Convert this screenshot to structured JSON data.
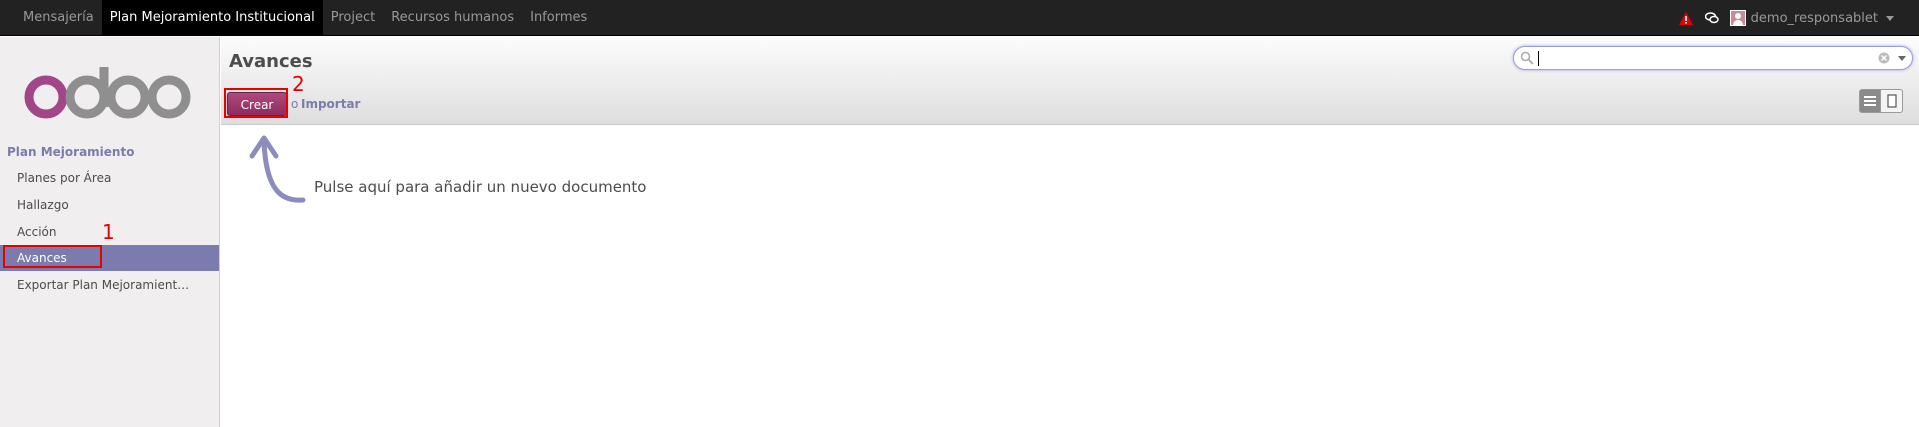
{
  "top_menu": {
    "items": [
      {
        "label": "Mensajería",
        "active": false
      },
      {
        "label": "Plan Mejoramiento Institucional",
        "active": true
      },
      {
        "label": "Project",
        "active": false
      },
      {
        "label": "Recursos humanos",
        "active": false
      },
      {
        "label": "Informes",
        "active": false
      }
    ],
    "user_name": "demo_responsablet",
    "icons": [
      "warning-icon",
      "chat-icon",
      "user-avatar",
      "chevron-down-icon"
    ]
  },
  "sidebar": {
    "logo_text": "odoo",
    "section_title": "Plan Mejoramiento",
    "items": [
      {
        "label": "Planes por Área",
        "active": false
      },
      {
        "label": "Hallazgo",
        "active": false
      },
      {
        "label": "Acción",
        "active": false
      },
      {
        "label": "Avances",
        "active": true
      },
      {
        "label": "Exportar Plan Mejoramient…",
        "active": false
      }
    ]
  },
  "header": {
    "title": "Avances",
    "create_label": "Crear",
    "or_label": "o",
    "import_label": "Importar",
    "search_placeholder": "",
    "view_modes": [
      "list-view-icon",
      "form-view-icon"
    ]
  },
  "main": {
    "help_text": "Pulse aquí para añadir un nuevo documento"
  },
  "annotations": {
    "marker_1": "1",
    "marker_2": "2"
  },
  "colors": {
    "topbar": "#222222",
    "accent": "#7c7bad",
    "create_button": "#a03c70",
    "annotation": "#e60000"
  }
}
